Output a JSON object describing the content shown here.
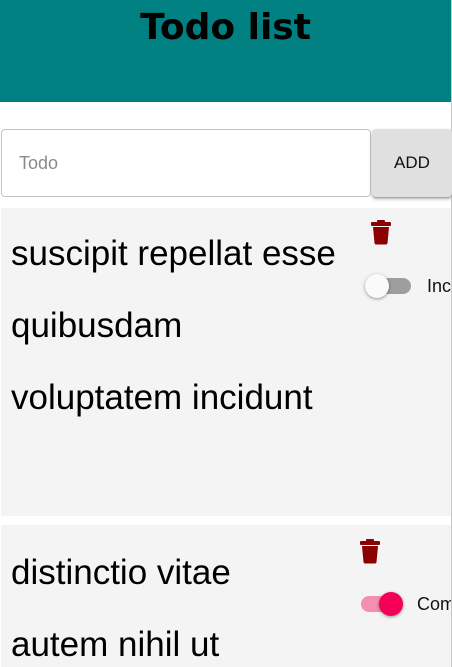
{
  "header": {
    "title": "Todo list",
    "background_color": "#008080"
  },
  "input": {
    "placeholder": "Todo",
    "value": ""
  },
  "add_button": {
    "label": "ADD"
  },
  "todos": [
    {
      "lines": [
        "suscipit repellat esse",
        "quibusdam",
        "voluptatem incidunt"
      ],
      "completed": false,
      "status_label": "Inc",
      "delete_icon": "trash-icon"
    },
    {
      "lines": [
        "distinctio vitae",
        "autem nihil ut"
      ],
      "completed": true,
      "status_label": "Com",
      "delete_icon": "trash-icon"
    }
  ],
  "colors": {
    "delete_icon": "#8b0000",
    "toggle_on_thumb": "#f50057",
    "toggle_on_track": "#f48fb1",
    "toggle_off_track": "#9e9e9e",
    "card_background": "#f4f4f4"
  }
}
